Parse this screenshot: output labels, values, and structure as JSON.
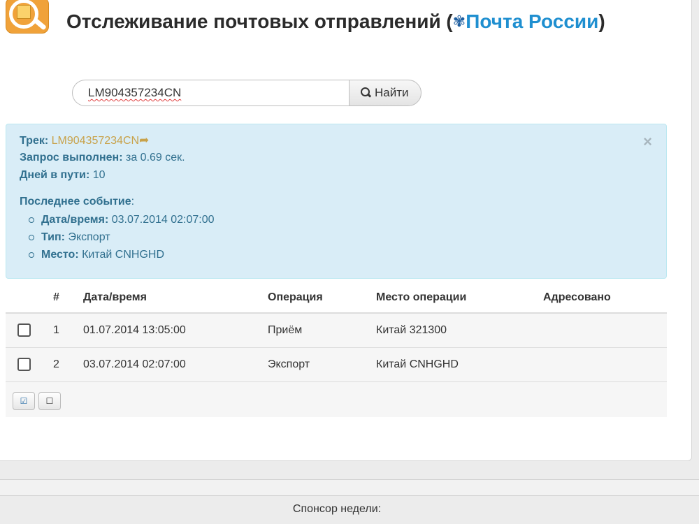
{
  "header": {
    "title_prefix": "Отслеживание почтовых отправлений (",
    "brand_link": "Почта России",
    "title_suffix": ")"
  },
  "search": {
    "value": "LM904357234CN",
    "button_label": "Найти"
  },
  "result": {
    "close_glyph": "×",
    "track_label": "Трек:",
    "track_value": "LM904357234CN",
    "query_label": "Запрос выполнен:",
    "query_value": "за 0.69 сек.",
    "days_label": "Дней в пути:",
    "days_value": "10",
    "last_event_label": "Последнее событие",
    "last_event_colon": ":",
    "datetime_label": "Дата/время:",
    "datetime_value": "03.07.2014 02:07:00",
    "type_label": "Тип:",
    "type_value": "Экспорт",
    "place_label": "Место:",
    "place_value": "Китай CNHGHD"
  },
  "table": {
    "headers": [
      "#",
      "Дата/время",
      "Операция",
      "Место операции",
      "Адресовано"
    ],
    "rows": [
      {
        "num": "1",
        "datetime": "01.07.2014 13:05:00",
        "operation": "Приём",
        "place": "Китай 321300",
        "addressed": ""
      },
      {
        "num": "2",
        "datetime": "03.07.2014 02:07:00",
        "operation": "Экспорт",
        "place": "Китай CNHGHD",
        "addressed": ""
      }
    ]
  },
  "footer": {
    "sponsor_label": "Спонсор недели:"
  },
  "icons": {
    "app_logo": "app-logo-icon",
    "eagle": "eagle-icon",
    "search": "search-icon",
    "share": "share-arrow-icon",
    "close": "close-icon",
    "select_all": "check-all-icon",
    "select_none": "uncheck-all-icon"
  },
  "colors": {
    "brand_link": "#1f8fd0",
    "alert_bg": "#d9edf7",
    "alert_text": "#31708f",
    "track_link": "#c8a24a"
  }
}
